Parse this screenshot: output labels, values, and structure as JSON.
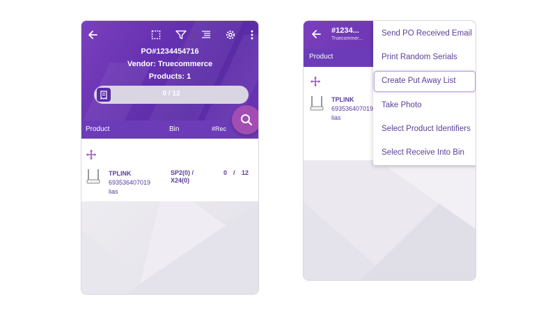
{
  "left": {
    "header": {
      "po": "PO#1234454716",
      "vendor": "Vendor: Truecommerce",
      "products": "Products: 1"
    },
    "icons": [
      "back-arrow-icon",
      "select-box-icon",
      "filter-icon",
      "list-icon",
      "gear-icon",
      "more-vert-icon"
    ],
    "progress": {
      "text": "0 / 12",
      "received": 0,
      "total": 12
    },
    "columns": {
      "product": "Product",
      "bin": "Bin",
      "rec": "#Rec"
    },
    "row": {
      "name": "TPLINK",
      "sku": "693536407019",
      "alias": "lias",
      "bin_line1": "SP2(0) /",
      "bin_line2": "X24(0)",
      "qty_received": "0",
      "qty_sep": "/",
      "qty_total": "12"
    }
  },
  "right": {
    "header": {
      "title": "#1234...",
      "subtitle": "Truecommer..."
    },
    "columns": {
      "product": "Product"
    },
    "row": {
      "name": "TPLINK",
      "sku": "693536407019",
      "alias": "lias"
    },
    "menu": [
      "Send PO Received Email",
      "Print Random Serials",
      "Create Put Away List",
      "Take Photo",
      "Select Product Identifiers",
      "Select Receive Into Bin"
    ],
    "highlighted_index": 2
  },
  "colors": {
    "accent": "#6b3bb8",
    "fab": "#a14db4",
    "text": "#5a3aa0"
  }
}
